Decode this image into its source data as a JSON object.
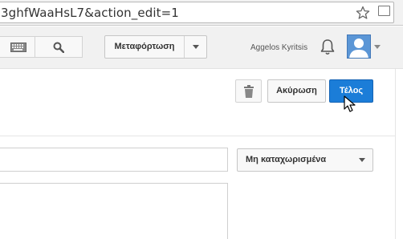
{
  "browser": {
    "url": "3ghfWaaHsL7&action_edit=1",
    "icons": [
      "star-icon",
      "page-icon"
    ]
  },
  "header": {
    "keyboard_icon": "keyboard-icon",
    "search_icon": "search-icon",
    "upload_label": "Μεταφόρτωση",
    "user_name": "Aggelos Kyritsis",
    "bell_icon": "bell-icon",
    "avatar_icon": "avatar-icon"
  },
  "actions": {
    "delete_icon": "trash-icon",
    "cancel_label": "Ακύρωση",
    "done_label": "Τέλος",
    "accent_color": "#1b7dd8"
  },
  "form": {
    "title_value": "",
    "privacy_selected": "Μη καταχωρισμένα",
    "description_value": ""
  }
}
